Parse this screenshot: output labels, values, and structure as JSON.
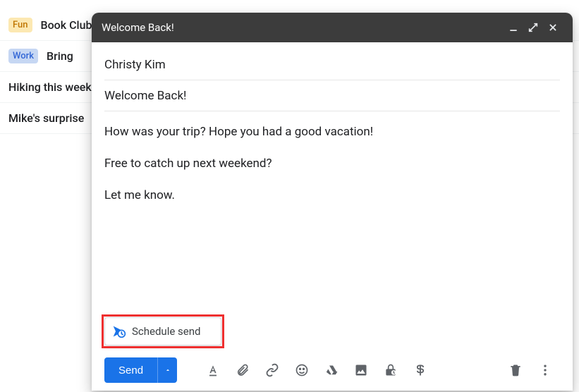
{
  "inbox": {
    "rows": [
      {
        "tag": "Fun",
        "tag_class": "tag-fun",
        "subject": "Book Club"
      },
      {
        "tag": "Work",
        "tag_class": "tag-work",
        "subject": "Bring"
      },
      {
        "tag": "",
        "tag_class": "",
        "subject": "Hiking this weekend"
      },
      {
        "tag": "",
        "tag_class": "",
        "subject": "Mike's surprise"
      }
    ]
  },
  "compose": {
    "title": "Welcome Back!",
    "to": "Christy Kim",
    "subject": "Welcome Back!",
    "body": [
      "How was your trip? Hope you had a good vacation!",
      "Free to catch up next weekend?",
      "Let me know."
    ],
    "schedule_label": "Schedule send",
    "send_label": "Send"
  }
}
